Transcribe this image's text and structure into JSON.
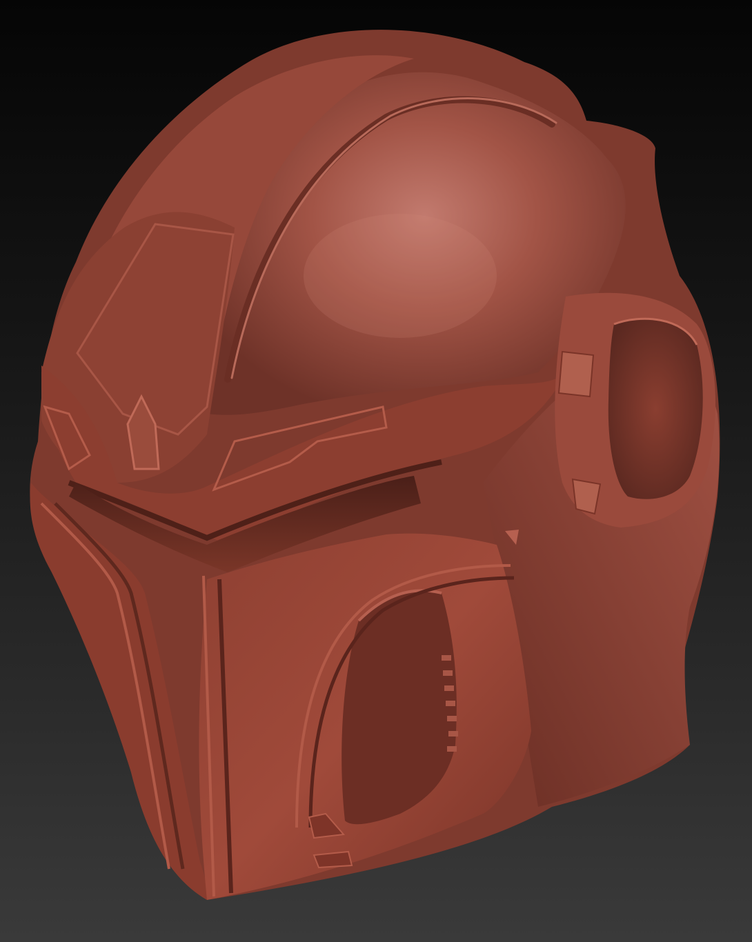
{
  "viewport": {
    "background_top": "#050505",
    "background_bottom": "#3a3a3a"
  },
  "model": {
    "subject": "helmet-sculpt",
    "material_color": "#9a4a3e",
    "highlight_color": "#c0786a",
    "shadow_color": "#5e2a22",
    "edge_color": "#b05a48"
  }
}
